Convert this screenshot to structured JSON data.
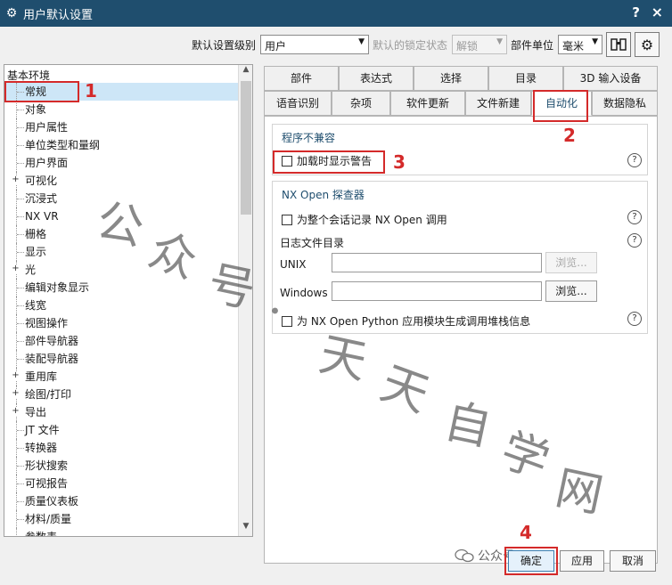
{
  "window": {
    "title": "用户默认设置",
    "help_label": "?",
    "close_label": "×"
  },
  "toolbar": {
    "level_label": "默认设置级别",
    "level_value": "用户",
    "lock_label": "默认的锁定状态",
    "lock_value": "解锁",
    "unit_label": "部件单位",
    "unit_value": "毫米"
  },
  "tree": {
    "root": "基本环境",
    "items": [
      {
        "label": "常规",
        "expandable": false,
        "selected": true
      },
      {
        "label": "对象",
        "expandable": false
      },
      {
        "label": "用户属性",
        "expandable": false
      },
      {
        "label": "单位类型和量纲",
        "expandable": false
      },
      {
        "label": "用户界面",
        "expandable": false
      },
      {
        "label": "可视化",
        "expandable": true
      },
      {
        "label": "沉浸式",
        "expandable": false
      },
      {
        "label": "NX VR",
        "expandable": false
      },
      {
        "label": "栅格",
        "expandable": false
      },
      {
        "label": "显示",
        "expandable": false
      },
      {
        "label": "光",
        "expandable": true
      },
      {
        "label": "编辑对象显示",
        "expandable": false
      },
      {
        "label": "线宽",
        "expandable": false
      },
      {
        "label": "视图操作",
        "expandable": false
      },
      {
        "label": "部件导航器",
        "expandable": false
      },
      {
        "label": "装配导航器",
        "expandable": false
      },
      {
        "label": "重用库",
        "expandable": true
      },
      {
        "label": "绘图/打印",
        "expandable": true
      },
      {
        "label": "导出",
        "expandable": true
      },
      {
        "label": "JT 文件",
        "expandable": false
      },
      {
        "label": "转换器",
        "expandable": false
      },
      {
        "label": "形状搜索",
        "expandable": false
      },
      {
        "label": "可视报告",
        "expandable": false
      },
      {
        "label": "质量仪表板",
        "expandable": false
      },
      {
        "label": "材料/质量",
        "expandable": false
      },
      {
        "label": "参数表",
        "expandable": false
      }
    ]
  },
  "tabs": {
    "row1": [
      "部件",
      "表达式",
      "选择",
      "目录",
      "3D 输入设备"
    ],
    "row2": [
      "语音识别",
      "杂项",
      "软件更新",
      "文件新建",
      "自动化",
      "数据隐私"
    ],
    "active": "自动化"
  },
  "panel": {
    "group1_title": "程序不兼容",
    "warn_on_load": "加载时显示警告",
    "group2_title": "NX Open 探查器",
    "record_nxopen": "为整个会话记录 NX Open 调用",
    "log_dir_label": "日志文件目录",
    "unix_label": "UNIX",
    "windows_label": "Windows",
    "browse_label": "浏览...",
    "python_stack": "为 NX Open Python 应用模块生成调用堆栈信息",
    "help": "?"
  },
  "footer": {
    "ok": "确定",
    "apply": "应用",
    "cancel": "取消",
    "wechat_text": "公众号"
  },
  "annotations": {
    "n1": "1",
    "n2": "2",
    "n3": "3",
    "n4": "4",
    "color": "#d42a2a"
  },
  "watermark": {
    "chars": [
      "公",
      "众",
      "号",
      "·",
      "天",
      "天",
      "自",
      "学",
      "网"
    ]
  }
}
